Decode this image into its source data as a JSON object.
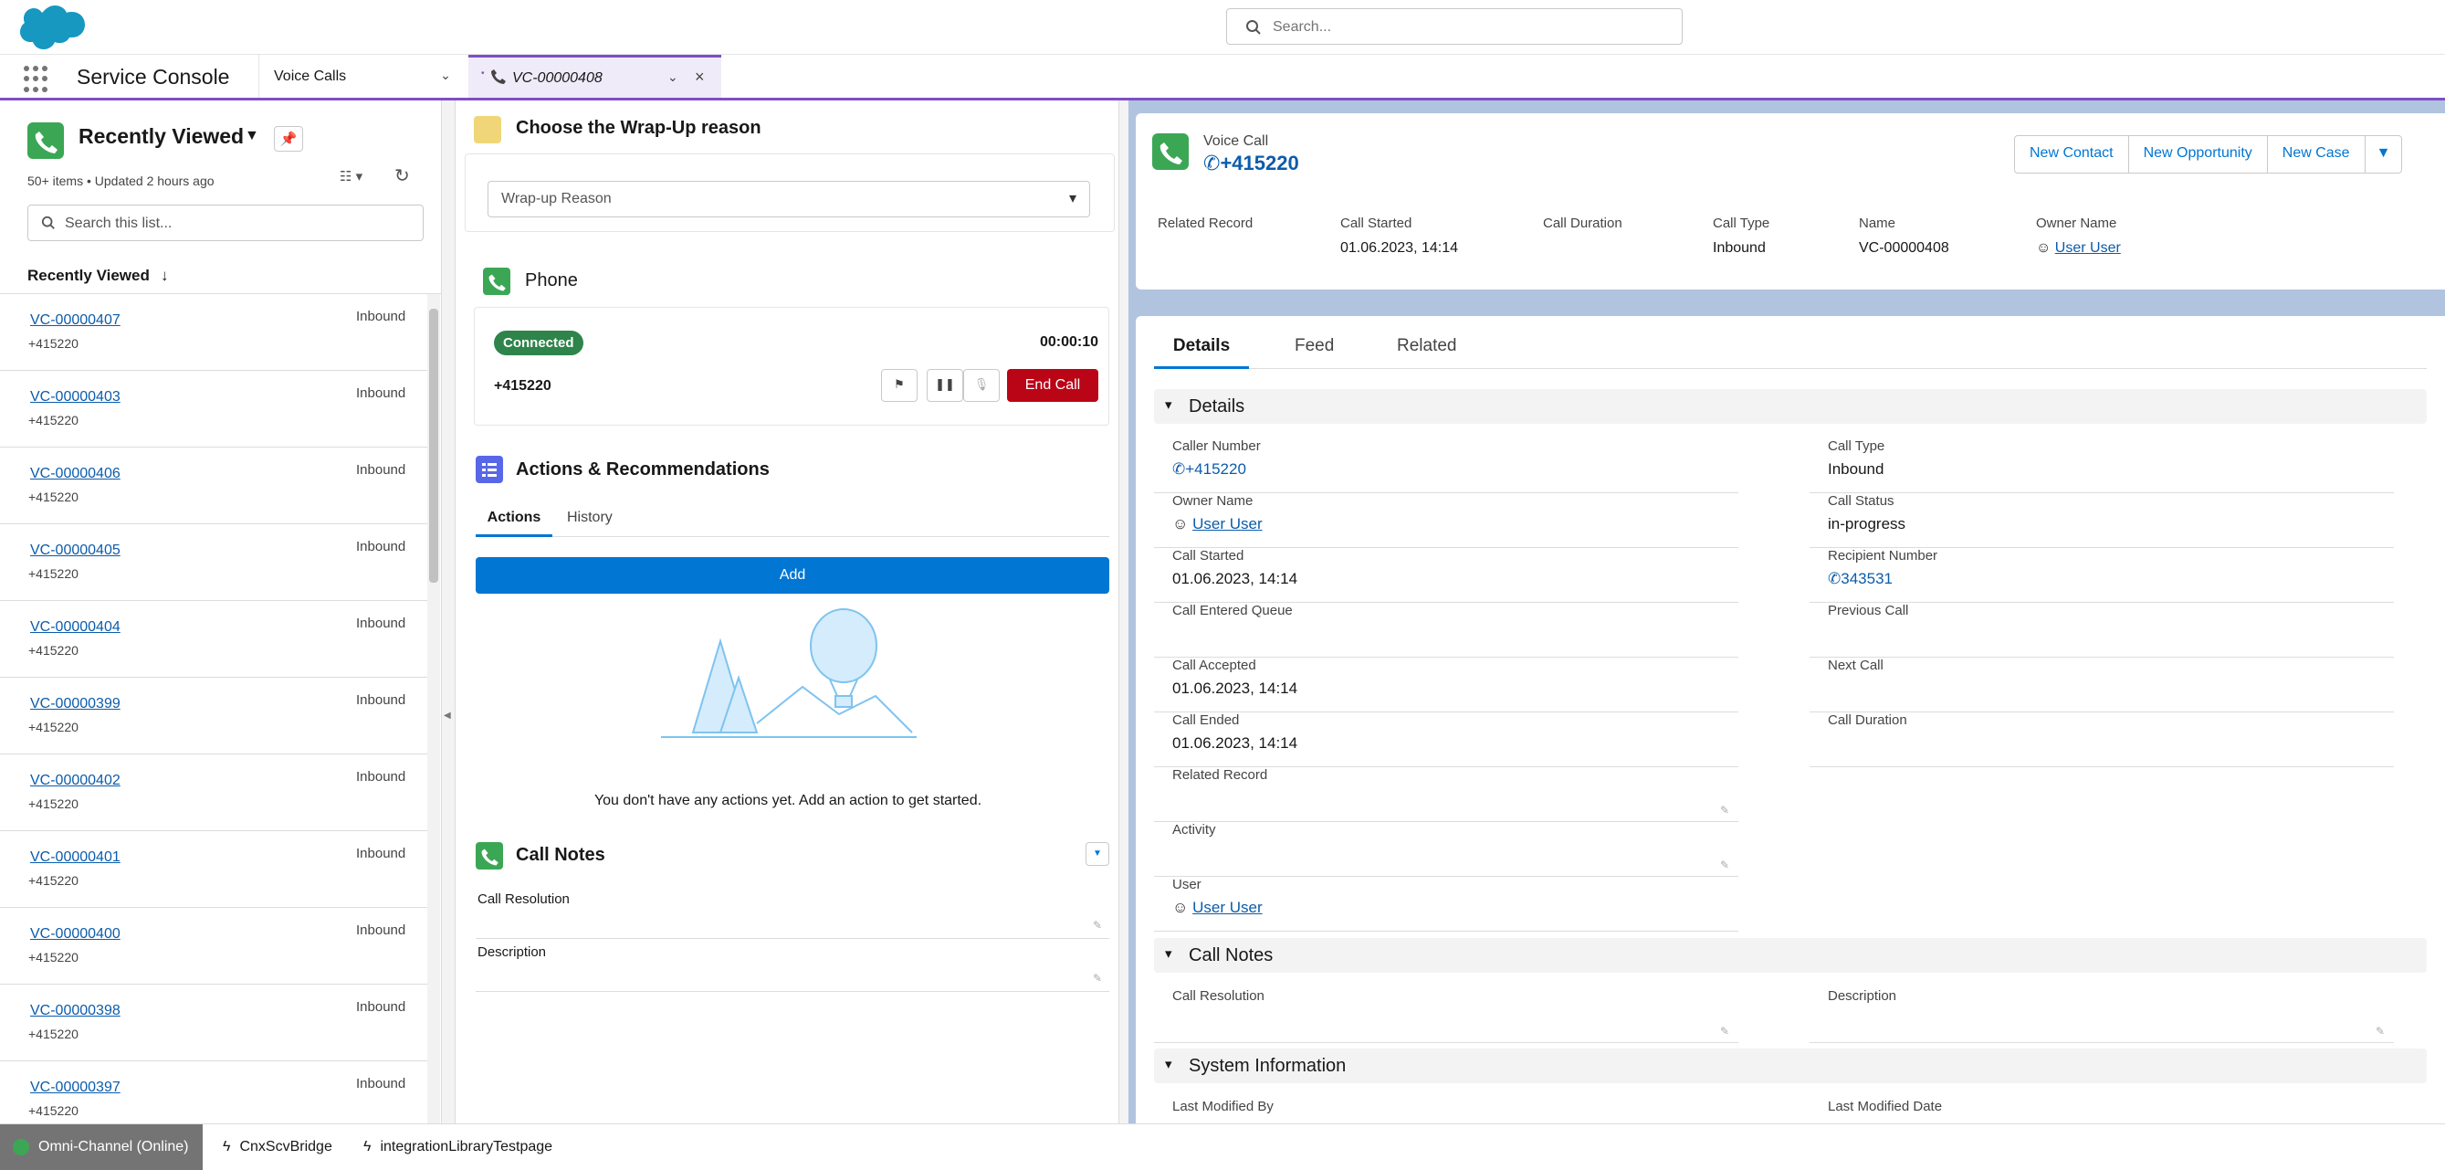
{
  "header": {
    "search_placeholder": "Search..."
  },
  "nav": {
    "app_name": "Service Console",
    "nav_item": "Voice Calls",
    "active_tab": "VC-00000408"
  },
  "list_view": {
    "title": "Recently Viewed",
    "meta": "50+ items • Updated 2 hours ago",
    "search_placeholder": "Search this list...",
    "column_header": "Recently Viewed",
    "rows": [
      {
        "id": "VC-00000407",
        "number": "+415220",
        "type": "Inbound"
      },
      {
        "id": "VC-00000403",
        "number": "+415220",
        "type": "Inbound"
      },
      {
        "id": "VC-00000406",
        "number": "+415220",
        "type": "Inbound"
      },
      {
        "id": "VC-00000405",
        "number": "+415220",
        "type": "Inbound"
      },
      {
        "id": "VC-00000404",
        "number": "+415220",
        "type": "Inbound"
      },
      {
        "id": "VC-00000399",
        "number": "+415220",
        "type": "Inbound"
      },
      {
        "id": "VC-00000402",
        "number": "+415220",
        "type": "Inbound"
      },
      {
        "id": "VC-00000401",
        "number": "+415220",
        "type": "Inbound"
      },
      {
        "id": "VC-00000400",
        "number": "+415220",
        "type": "Inbound"
      },
      {
        "id": "VC-00000398",
        "number": "+415220",
        "type": "Inbound"
      },
      {
        "id": "VC-00000397",
        "number": "+415220",
        "type": "Inbound"
      }
    ]
  },
  "wrapup": {
    "title": "Choose the Wrap-Up reason",
    "placeholder": "Wrap-up Reason"
  },
  "phone": {
    "title": "Phone",
    "status": "Connected",
    "timer": "00:00:10",
    "number": "+415220",
    "end_call": "End Call"
  },
  "actions": {
    "title": "Actions & Recommendations",
    "tab_actions": "Actions",
    "tab_history": "History",
    "add": "Add",
    "empty": "You don't have any actions yet. Add an action to get started."
  },
  "call_notes": {
    "title": "Call Notes",
    "resolution": "Call Resolution",
    "description": "Description"
  },
  "record": {
    "object": "Voice Call",
    "title": "+415220",
    "actions": [
      "New Contact",
      "New Opportunity",
      "New Case"
    ],
    "highlights": {
      "related_record_label": "Related Record",
      "call_started_label": "Call Started",
      "call_started": "01.06.2023, 14:14",
      "call_duration_label": "Call Duration",
      "call_type_label": "Call Type",
      "call_type": "Inbound",
      "name_label": "Name",
      "name": "VC-00000408",
      "owner_label": "Owner Name",
      "owner": "User User"
    },
    "tabs": [
      "Details",
      "Feed",
      "Related"
    ],
    "sections": {
      "details": "Details",
      "call_notes": "Call Notes",
      "system": "System Information"
    },
    "details_left": [
      {
        "label": "Caller Number",
        "value": "+415220"
      },
      {
        "label": "Owner Name",
        "value": "User User"
      },
      {
        "label": "Call Started",
        "value": "01.06.2023, 14:14"
      },
      {
        "label": "Call Entered Queue",
        "value": ""
      },
      {
        "label": "Call Accepted",
        "value": "01.06.2023, 14:14"
      },
      {
        "label": "Call Ended",
        "value": "01.06.2023, 14:14"
      },
      {
        "label": "Related Record",
        "value": ""
      },
      {
        "label": "Activity",
        "value": ""
      },
      {
        "label": "User",
        "value": "User User"
      }
    ],
    "details_right": [
      {
        "label": "Call Type",
        "value": "Inbound"
      },
      {
        "label": "Call Status",
        "value": "in-progress"
      },
      {
        "label": "Recipient Number",
        "value": "343531"
      },
      {
        "label": "Previous Call",
        "value": ""
      },
      {
        "label": "Next Call",
        "value": ""
      },
      {
        "label": "Call Duration",
        "value": ""
      }
    ],
    "notes_fields": [
      "Call Resolution",
      "Description"
    ],
    "system_fields": [
      "Last Modified By",
      "Last Modified Date"
    ]
  },
  "utility_bar": {
    "omni": "Omni-Channel (Online)",
    "item1": "CnxScvBridge",
    "item2": "integrationLibraryTestpage"
  },
  "colors": {
    "brand_blue": "#0176d3",
    "link_blue": "#0b5cab",
    "green_icon": "#3ba755",
    "end_call_red": "#ba0517",
    "tab_purple": "#7f4fc5"
  }
}
